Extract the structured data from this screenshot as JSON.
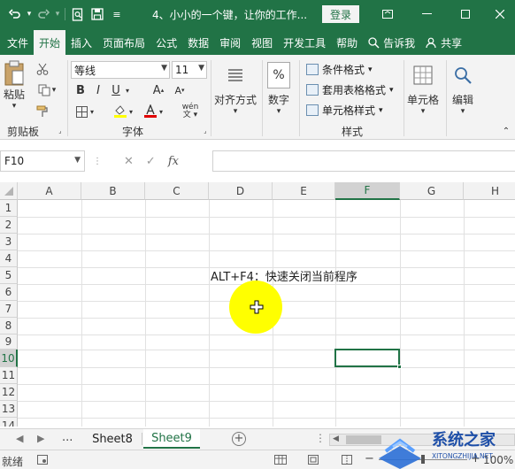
{
  "titlebar": {
    "title": "4、小小的一个键，让你的工作...",
    "login": "登录"
  },
  "tabs": [
    "文件",
    "开始",
    "插入",
    "页面布局",
    "公式",
    "数据",
    "审阅",
    "视图",
    "开发工具",
    "帮助"
  ],
  "tell_me": "告诉我",
  "share": "共享",
  "ribbon": {
    "clipboard": {
      "paste": "粘贴",
      "group": "剪贴板"
    },
    "font": {
      "name": "等线",
      "size": "11",
      "group": "字体",
      "phonetic": "wén"
    },
    "align": {
      "label": "对齐方式"
    },
    "number": {
      "label": "数字",
      "icon_glyph": "%"
    },
    "styles": {
      "conditional": "条件格式",
      "table": "套用表格格式",
      "cell_styles": "单元格样式",
      "group": "样式"
    },
    "cells": {
      "label": "单元格"
    },
    "editing": {
      "label": "编辑"
    }
  },
  "formula_bar": {
    "name_box": "F10",
    "fx": "fx",
    "value": ""
  },
  "grid": {
    "columns": [
      "A",
      "B",
      "C",
      "D",
      "E",
      "F",
      "G",
      "H"
    ],
    "rows": [
      "1",
      "2",
      "3",
      "4",
      "5",
      "6",
      "7",
      "8",
      "9",
      "10",
      "11",
      "12",
      "13",
      "14"
    ],
    "selected_column": "F",
    "selected_row": "10",
    "cell_D5": "ALT+F4：快速关闭当前程序"
  },
  "sheets": {
    "ellipsis": "...",
    "tabs": [
      "Sheet8",
      "Sheet9"
    ],
    "active": "Sheet9"
  },
  "status": {
    "ready": "就绪",
    "zoom": "100%"
  },
  "watermark": {
    "brand": "系统之家",
    "url": "XITONGZHIJIA.NET"
  },
  "colors": {
    "accent": "#217346",
    "halo": "#ffff00"
  }
}
